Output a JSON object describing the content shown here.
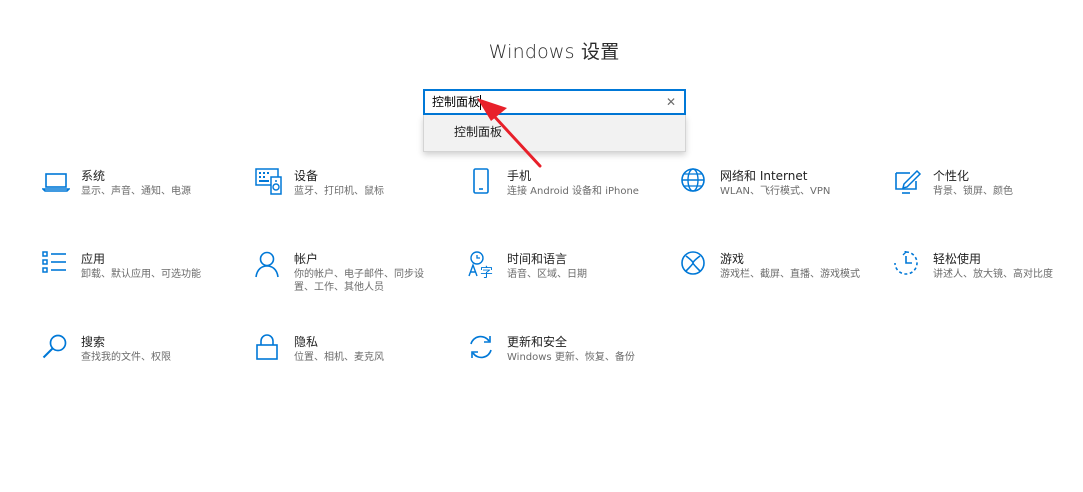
{
  "page": {
    "title": "Windows 设置"
  },
  "search": {
    "value": "控制面板",
    "clear_icon": "close-icon"
  },
  "suggestions": [
    {
      "label": "控制面板"
    }
  ],
  "tiles": [
    {
      "title": "系统",
      "desc": "显示、声音、通知、电源",
      "icon": "laptop-icon"
    },
    {
      "title": "设备",
      "desc": "蓝牙、打印机、鼠标",
      "icon": "devices-icon"
    },
    {
      "title": "手机",
      "desc": "连接 Android 设备和 iPhone",
      "icon": "phone-icon"
    },
    {
      "title": "网络和 Internet",
      "desc": "WLAN、飞行模式、VPN",
      "icon": "globe-icon"
    },
    {
      "title": "个性化",
      "desc": "背景、锁屏、颜色",
      "icon": "personalize-icon"
    },
    {
      "title": "应用",
      "desc": "卸载、默认应用、可选功能",
      "icon": "apps-list-icon"
    },
    {
      "title": "帐户",
      "desc": "你的帐户、电子邮件、同步设置、工作、其他人员",
      "icon": "person-icon"
    },
    {
      "title": "时间和语言",
      "desc": "语音、区域、日期",
      "icon": "time-language-icon"
    },
    {
      "title": "游戏",
      "desc": "游戏栏、截屏、直播、游戏模式",
      "icon": "xbox-icon"
    },
    {
      "title": "轻松使用",
      "desc": "讲述人、放大镜、高对比度",
      "icon": "ease-of-access-icon"
    },
    {
      "title": "搜索",
      "desc": "查找我的文件、权限",
      "icon": "search-icon"
    },
    {
      "title": "隐私",
      "desc": "位置、相机、麦克风",
      "icon": "lock-icon"
    },
    {
      "title": "更新和安全",
      "desc": "Windows 更新、恢复、备份",
      "icon": "sync-icon"
    }
  ],
  "colors": {
    "accent": "#0078d7",
    "annotation": "#e8202a"
  }
}
